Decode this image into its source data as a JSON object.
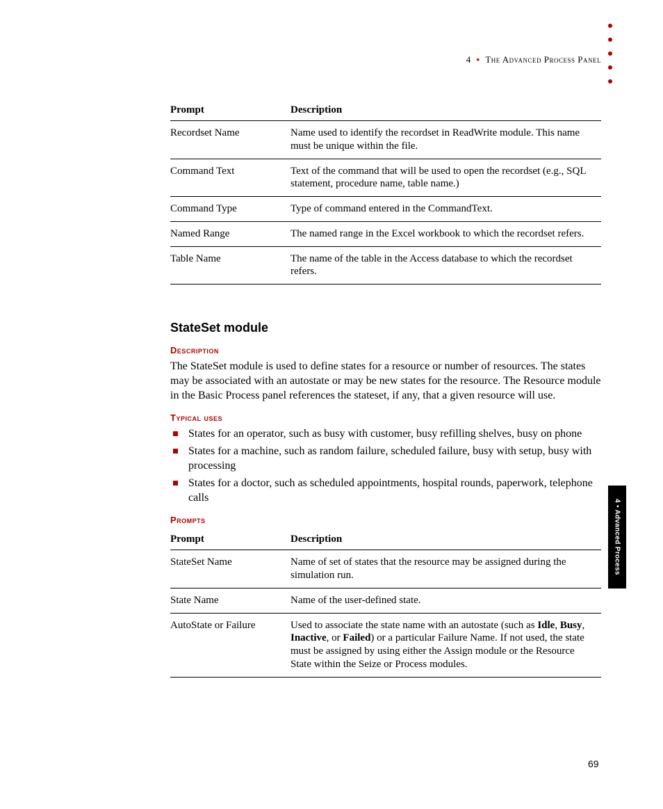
{
  "header": {
    "chapter_num": "4",
    "title": "The Advanced Process Panel"
  },
  "table1": {
    "head_prompt": "Prompt",
    "head_desc": "Description",
    "rows": [
      {
        "prompt": "Recordset Name",
        "desc": "Name used to identify the recordset in ReadWrite module. This name must be unique within the file."
      },
      {
        "prompt": "Command Text",
        "desc": "Text of the command that will be used to open the recordset (e.g., SQL statement, procedure name, table name.)"
      },
      {
        "prompt": "Command Type",
        "desc": "Type of command entered in the CommandText."
      },
      {
        "prompt": "Named Range",
        "desc": "The named range in the Excel workbook to which the recordset refers."
      },
      {
        "prompt": "Table Name",
        "desc": "The name of the table in the Access database to which the recordset refers."
      }
    ]
  },
  "module": {
    "title": "StateSet module",
    "desc_head": "Description",
    "desc_body": "The StateSet module is used to define states for a resource or number of resources. The states may be associated with an autostate or may be new states for the resource. The Resource module in the Basic Process panel references the stateset, if any, that a given resource will use.",
    "uses_head": "Typical uses",
    "uses": [
      "States for an operator, such as busy with customer, busy refilling shelves, busy on phone",
      "States for a machine, such as random failure, scheduled failure, busy with setup, busy with processing",
      "States for a doctor, such as scheduled appointments, hospital rounds, paperwork, telephone calls"
    ],
    "prompts_head": "Prompts"
  },
  "table2": {
    "head_prompt": "Prompt",
    "head_desc": "Description",
    "rows": [
      {
        "prompt": "StateSet Name",
        "desc": "Name of set of states that the resource may be assigned during the simulation run."
      },
      {
        "prompt": "State Name",
        "desc": "Name of the user-defined state."
      },
      {
        "prompt": "AutoState or Failure",
        "desc_pre": "Used to associate the state name with an autostate (such as ",
        "b1": "Idle",
        "s1": ", ",
        "b2": "Busy",
        "s2": ", ",
        "b3": "Inactive",
        "s3": ", or ",
        "b4": "Failed",
        "desc_post": ") or a particular Failure Name. If not used, the state must be assigned by using either the Assign module or the Resource State within the Seize or Process modules."
      }
    ]
  },
  "side_tab": "4 • Advanced Process",
  "page_number": "69"
}
